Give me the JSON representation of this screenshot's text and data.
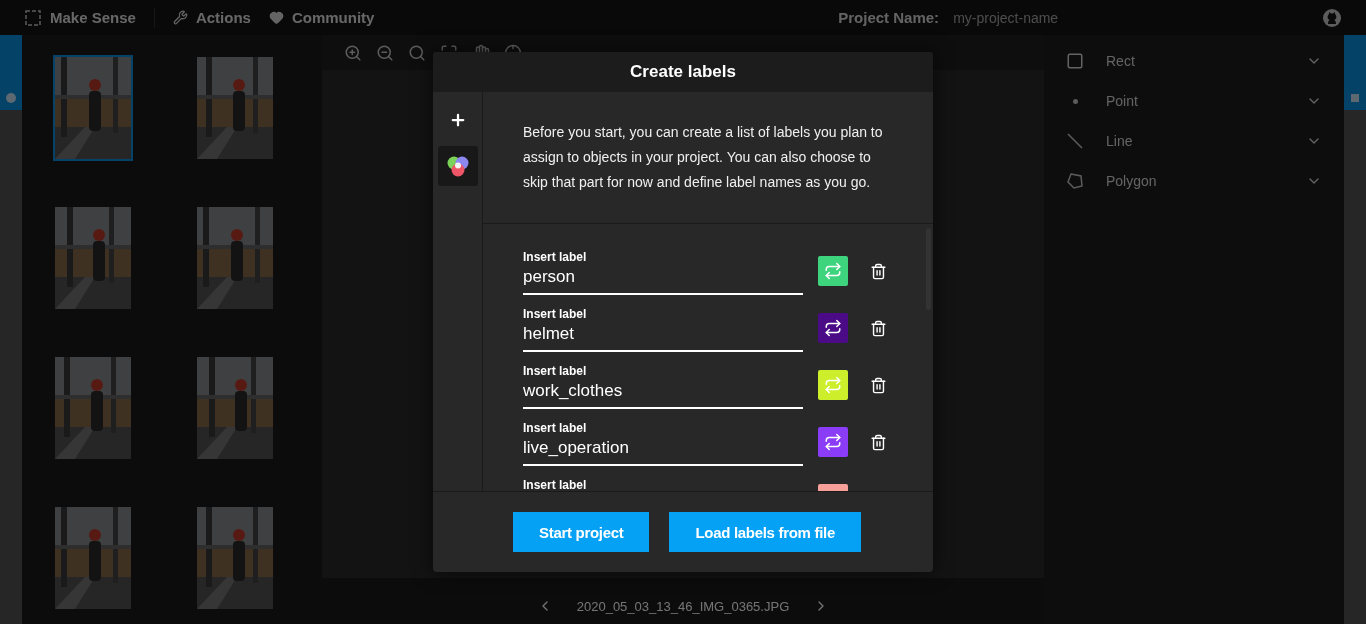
{
  "topbar": {
    "app_name": "Make Sense",
    "menu": [
      {
        "label": "Actions",
        "kind": "actions"
      },
      {
        "label": "Community",
        "kind": "community"
      }
    ],
    "project_label": "Project Name:",
    "project_name": "my-project-name"
  },
  "images": [
    {
      "selected": true
    },
    {
      "selected": false
    },
    {
      "selected": false
    },
    {
      "selected": false
    },
    {
      "selected": false
    },
    {
      "selected": false
    },
    {
      "selected": false
    },
    {
      "selected": false
    }
  ],
  "tools": [
    {
      "label": "Rect",
      "kind": "rect"
    },
    {
      "label": "Point",
      "kind": "point"
    },
    {
      "label": "Line",
      "kind": "line"
    },
    {
      "label": "Polygon",
      "kind": "polygon"
    }
  ],
  "footer": {
    "filename": "2020_05_03_13_46_IMG_0365.JPG"
  },
  "modal": {
    "title": "Create labels",
    "description": "Before you start, you can create a list of labels you plan to assign to objects in your project. You can also choose to skip that part for now and define label names as you go.",
    "labels": [
      {
        "caption": "Insert label",
        "value": "person",
        "color": "#3ed47e"
      },
      {
        "caption": "Insert label",
        "value": "helmet",
        "color": "#4b0a86"
      },
      {
        "caption": "Insert label",
        "value": "work_clothes",
        "color": "#cdee2a"
      },
      {
        "caption": "Insert label",
        "value": "live_operation",
        "color": "#8a3cf6"
      },
      {
        "caption": "Insert label",
        "color": "#f7a09a"
      }
    ],
    "buttons": [
      "Start project",
      "Load labels from file"
    ]
  }
}
